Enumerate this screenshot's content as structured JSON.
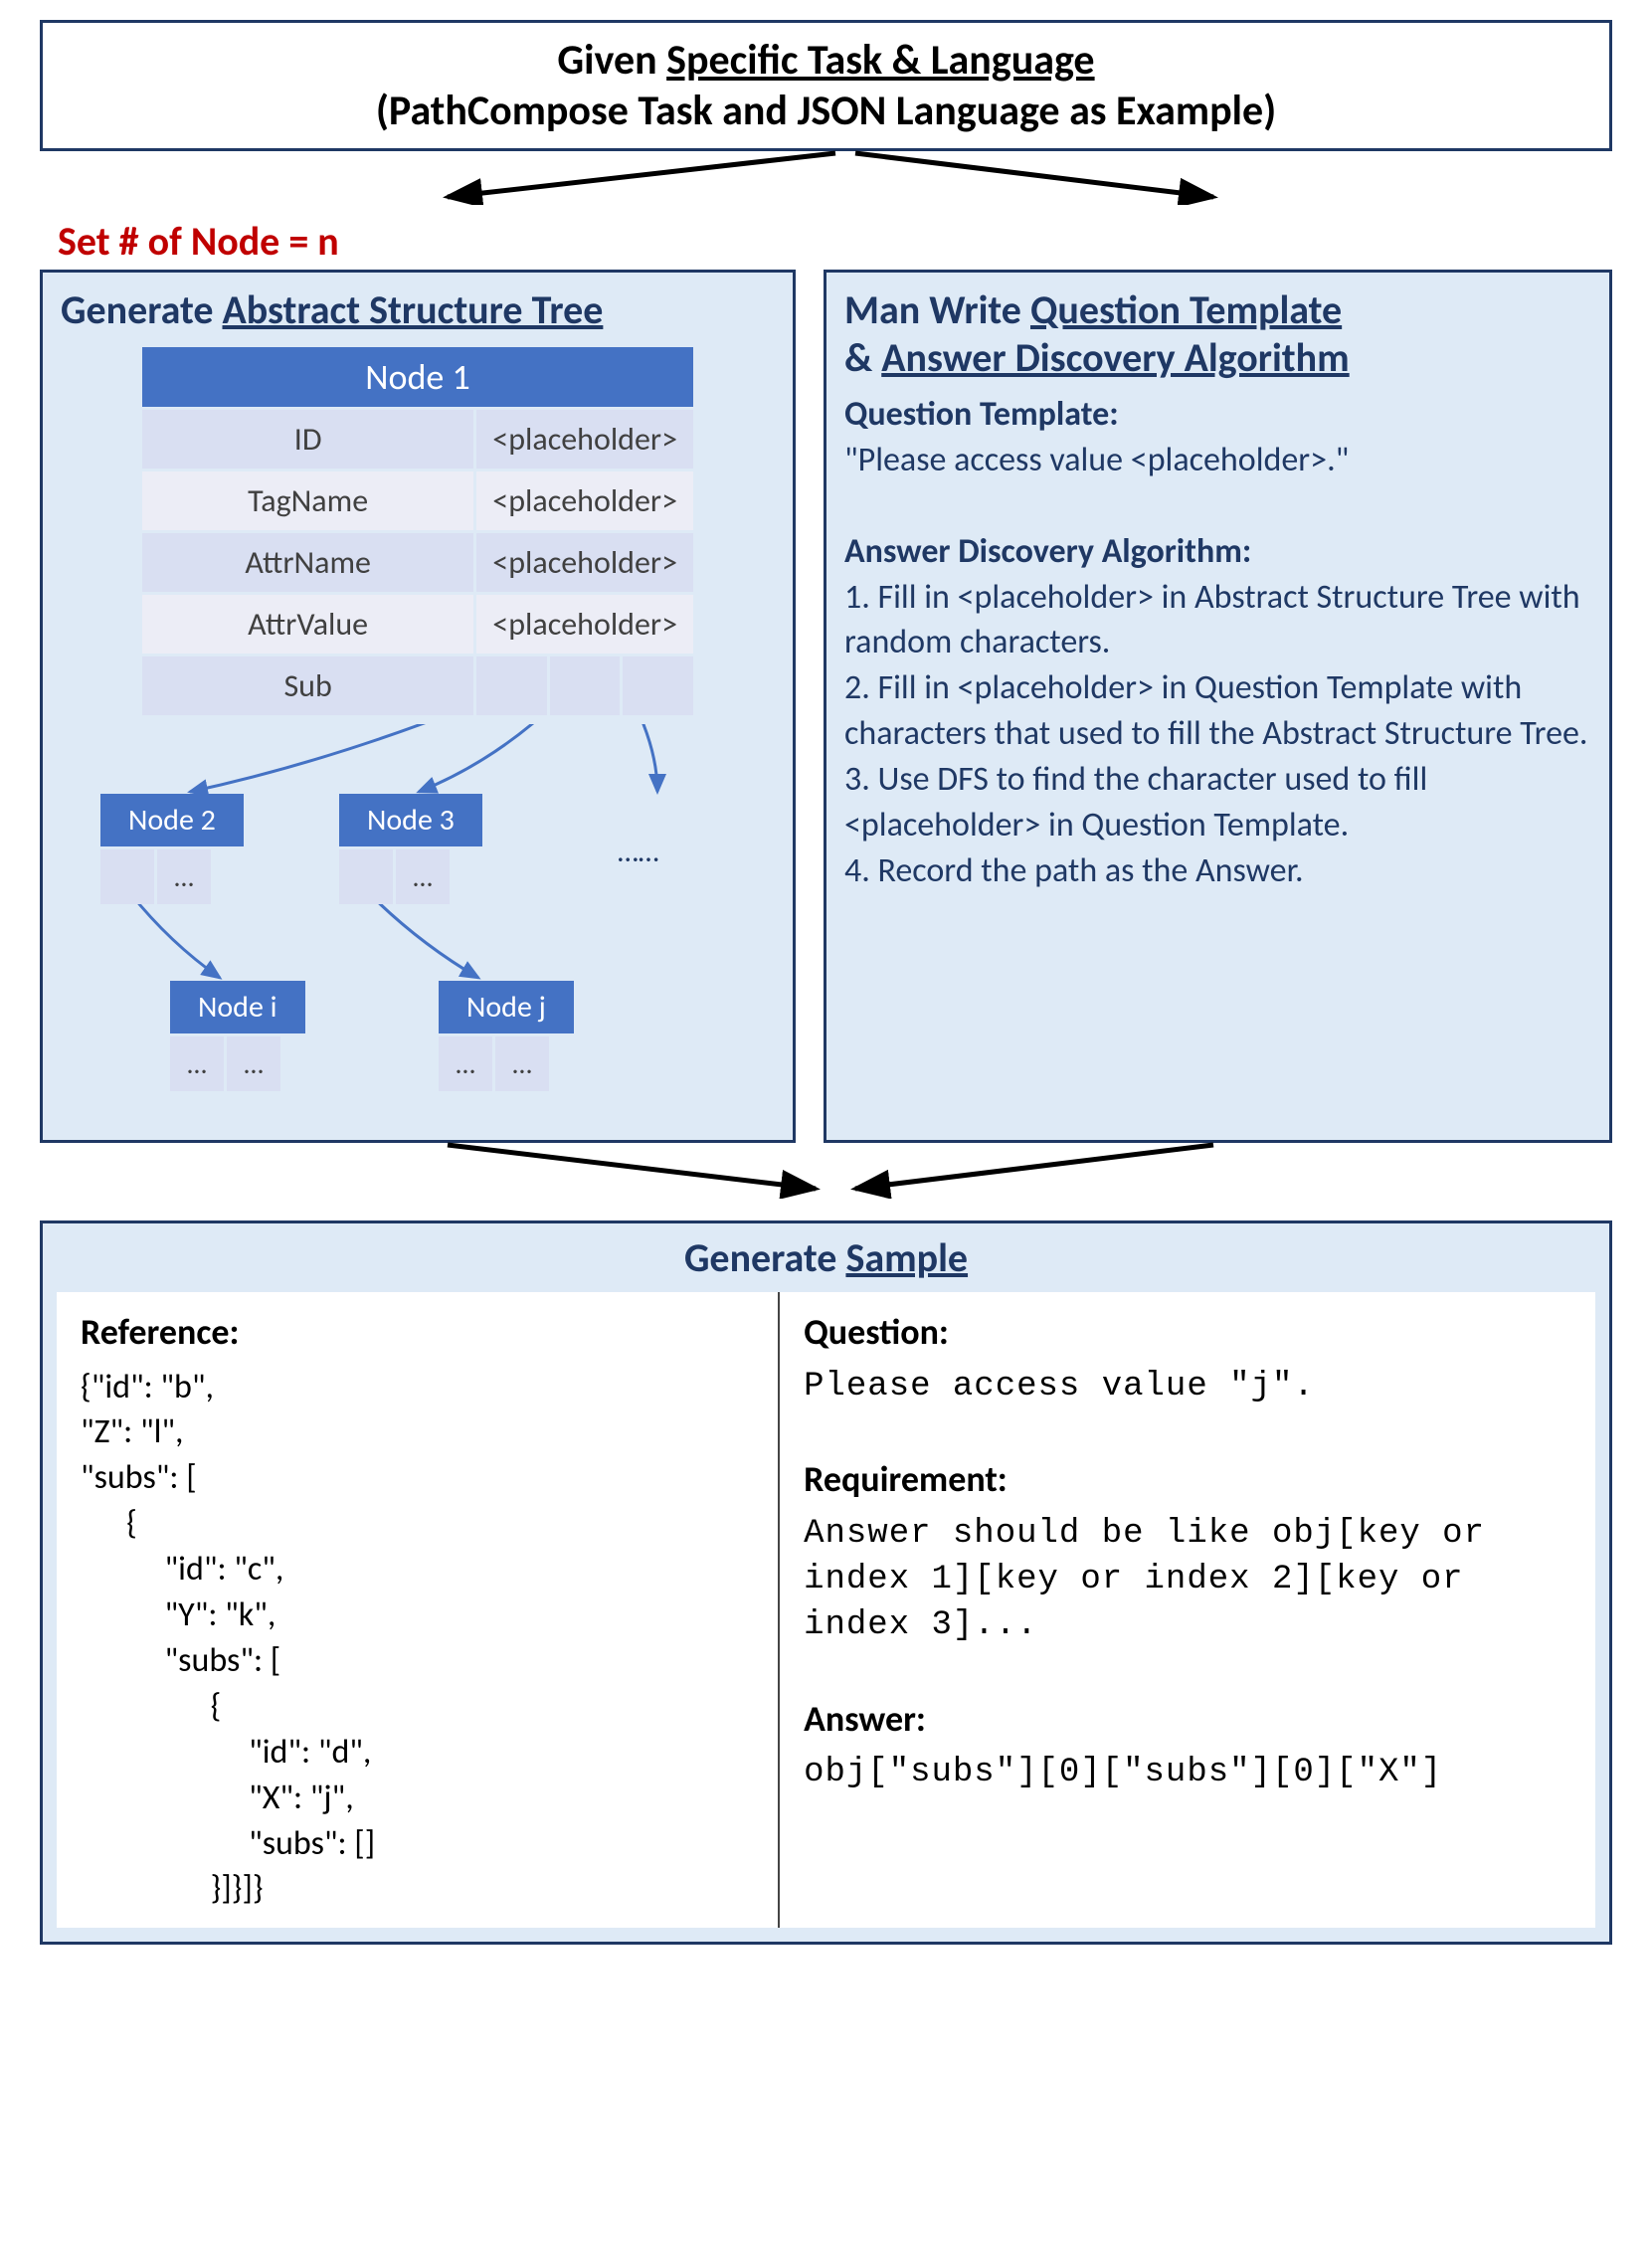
{
  "top": {
    "line1_prefix": "Given ",
    "line1_ul": "Specific Task & Language",
    "line2": "(PathCompose Task and JSON Language as Example)"
  },
  "set_node": "Set # of Node = n",
  "left": {
    "title_prefix": "Generate ",
    "title_ul": "Abstract Structure Tree",
    "node1": "Node 1",
    "rows": {
      "r1k": "ID",
      "r1v": "<placeholder>",
      "r2k": "TagName",
      "r2v": "<placeholder>",
      "r3k": "AttrName",
      "r3v": "<placeholder>",
      "r4k": "AttrValue",
      "r4v": "<placeholder>",
      "r5k": "Sub"
    },
    "node2": "Node 2",
    "node3": "Node 3",
    "nodei": "Node i",
    "nodej": "Node j",
    "ellipsis": "……",
    "dots": "…"
  },
  "right": {
    "title_l1": "Man Write ",
    "title_l1_ul": "Question Template",
    "title_l2_prefix": "& ",
    "title_l2_ul": "Answer Discovery Algorithm",
    "qt_label": "Question Template:",
    "qt_text": "\"Please access value <placeholder>.\"",
    "ada_label": "Answer Discovery Algorithm:",
    "s1": "1. Fill in <placeholder> in Abstract Structure Tree with random characters.",
    "s2": "2. Fill in <placeholder> in Question Template with characters that used to fill the Abstract Structure Tree.",
    "s3": "3. Use DFS to find the character used to fill <placeholder> in Question Template.",
    "s4": "4. Record the path as the Answer."
  },
  "bottom": {
    "title_prefix": "Generate ",
    "title_ul": "Sample",
    "ref_label": "Reference:",
    "ref_json": "{\"id\": \"b\",\n\"Z\": \"l\",\n\"subs\": [\n      {\n           \"id\": \"c\",\n           \"Y\": \"k\",\n           \"subs\": [\n                 {\n                      \"id\": \"d\",\n                      \"X\": \"j\",\n                      \"subs\": []\n                 }]}]}",
    "q_label": "Question:",
    "q_text": "Please access value \"j\".",
    "req_label": "Requirement:",
    "req_text": "Answer should be like obj[key or index 1][key or index 2][key or index 3]...",
    "ans_label": "Answer:",
    "ans_text": "obj[\"subs\"][0][\"subs\"][0][\"X\"]"
  }
}
